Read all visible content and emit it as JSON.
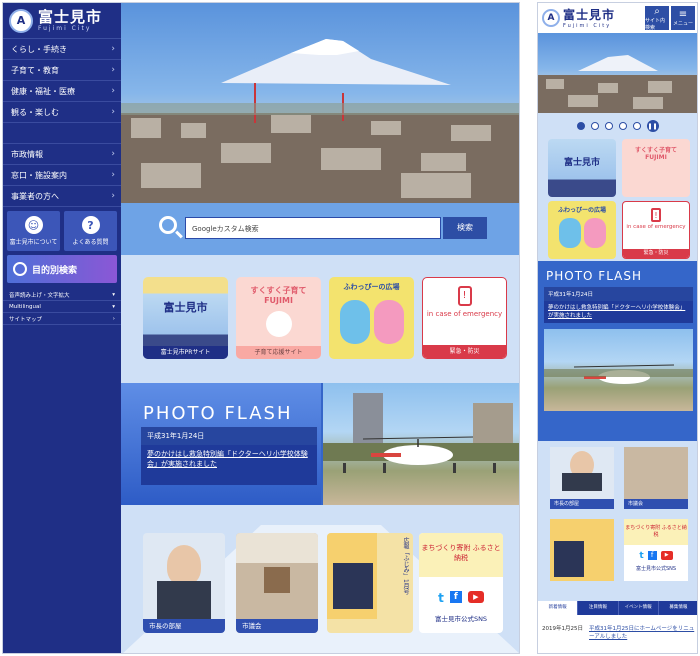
{
  "site": {
    "title_jp": "富士見市",
    "title_en": "Fujimi City",
    "logo_letter": "A"
  },
  "sidebar": {
    "menu": [
      {
        "label": "くらし・手続き"
      },
      {
        "label": "子育て・教育"
      },
      {
        "label": "健康・福祉・医療"
      },
      {
        "label": "観る・楽しむ"
      },
      {
        "label": "市政情報"
      },
      {
        "label": "窓口・施設案内"
      },
      {
        "label": "事業者の方へ"
      }
    ],
    "tile_about": "富士見市について",
    "tile_faq": "よくある質問",
    "purpose_search": "目的別検索",
    "small_links": [
      {
        "label": "音声読み上げ・文字拡大"
      },
      {
        "label": "Multilingual"
      },
      {
        "label": "サイトマップ"
      }
    ]
  },
  "search": {
    "placeholder": "Googleカスタム検索",
    "button": "検索"
  },
  "banners": [
    {
      "title": "富士見市",
      "caption": "富士見市PRサイト"
    },
    {
      "title": "すくすく子育て FUJIMI",
      "caption": "子育て応援サイト"
    },
    {
      "title": "ふわっぴーの広場",
      "caption": ""
    },
    {
      "title": "in case of emergency",
      "caption": "緊急・防災"
    }
  ],
  "photo_flash": {
    "title": "PHOTO FLASH",
    "date": "平成31年1月24日",
    "link": "夢のかけはし救急特別編「ドクターヘリ小学校体験会」が実施されました"
  },
  "bottom_cards": [
    {
      "caption": "市長の部屋"
    },
    {
      "caption": "市議会"
    },
    {
      "caption": "広報「ふじみ」1月号"
    },
    {
      "caption": "富士見市公式SNS",
      "extra": "まちづくり寄附 ふるさと納税"
    }
  ],
  "mobile": {
    "search_btn": "サイト内検索",
    "menu_btn": "メニュー",
    "tabs": [
      {
        "label": "新着情報"
      },
      {
        "label": "注目情報"
      },
      {
        "label": "イベント情報"
      },
      {
        "label": "募集情報"
      }
    ],
    "news_date": "2019年1月25日",
    "news_text": "平成31年1月25日にホームページをリニューアルしました"
  },
  "colors": {
    "brand": "#1f2f86",
    "accent": "#2d4ea5",
    "bg": "#cfe0f6"
  }
}
